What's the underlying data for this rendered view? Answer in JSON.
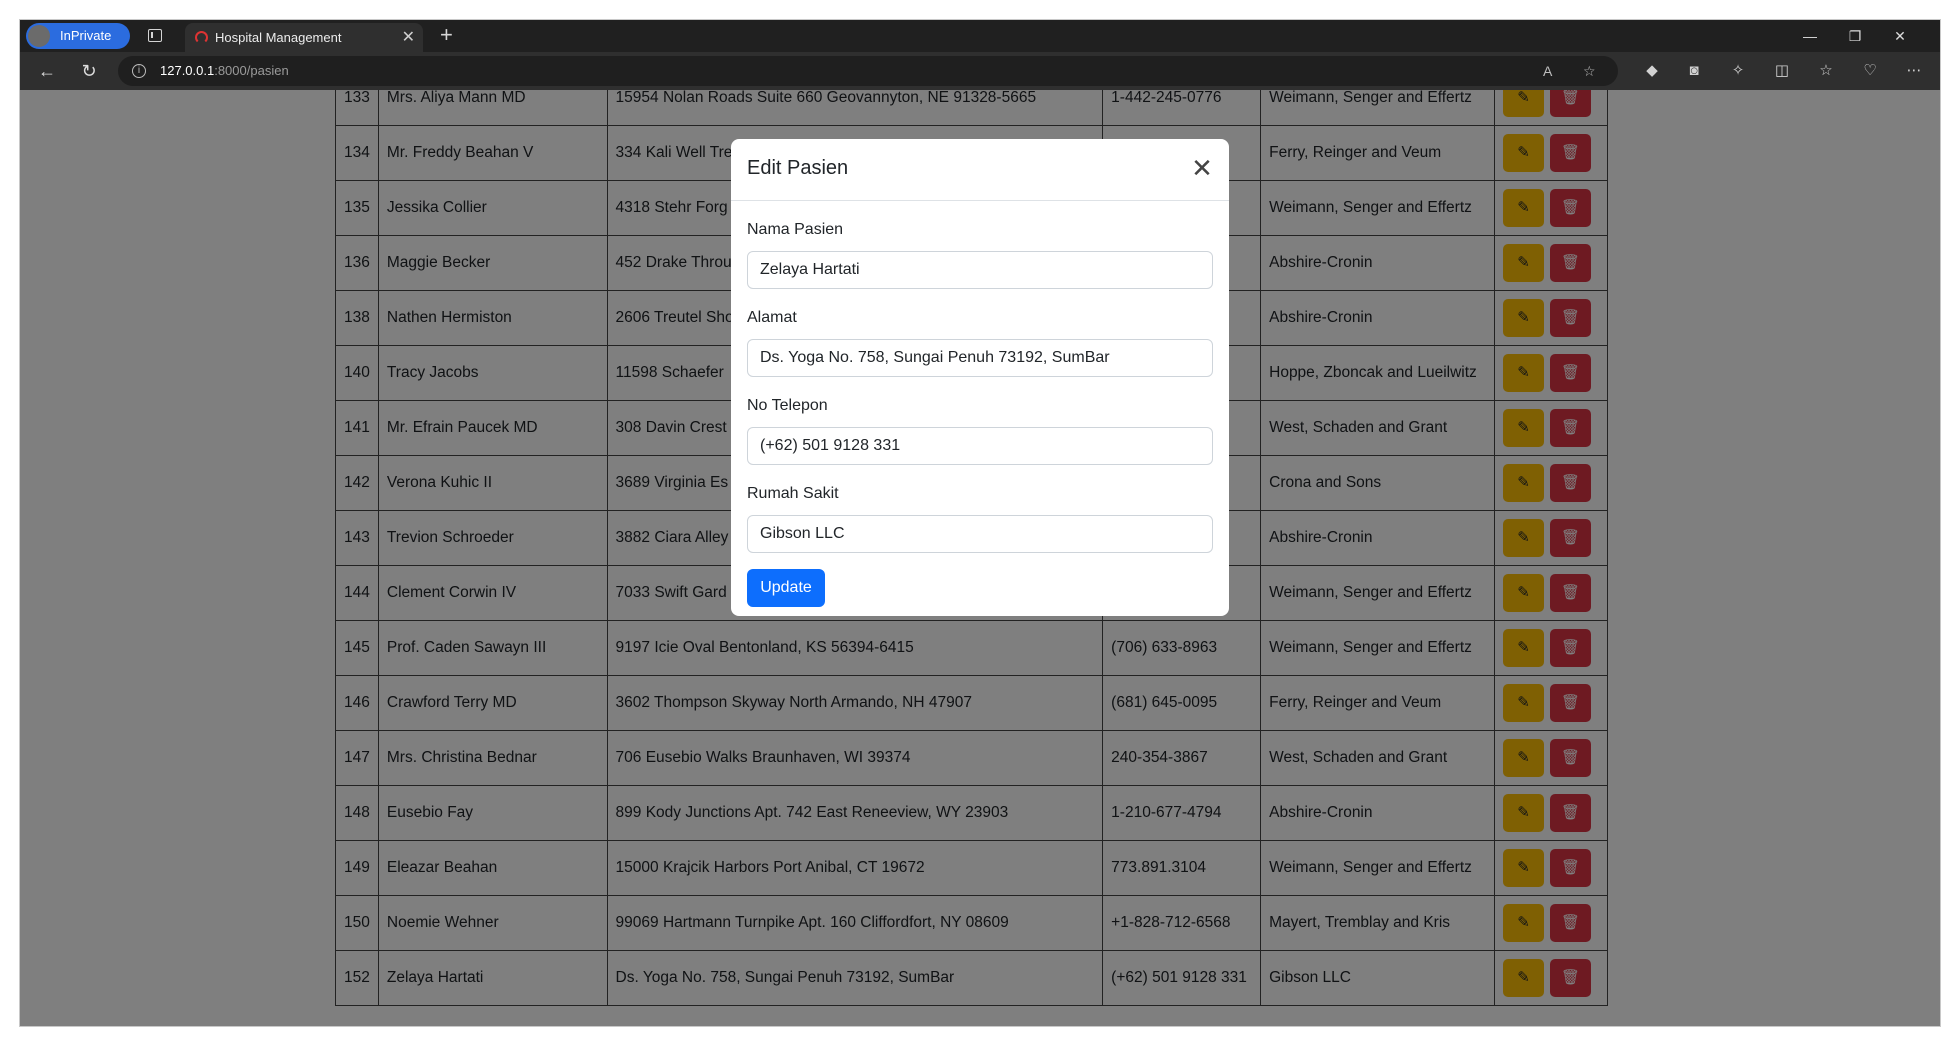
{
  "browser": {
    "profile_label": "InPrivate (2)",
    "tab_title": "Hospital Management",
    "url_host": "127.0.0.1",
    "url_rest": ":8000/pasien"
  },
  "patients": [
    {
      "id": "133",
      "name": "Mrs. Aliya Mann MD",
      "address": "15954 Nolan Roads Suite 660 Geovannyton, NE 91328-5665",
      "phone": "1-442-245-0776",
      "hospital": "Weimann, Senger and Effertz"
    },
    {
      "id": "134",
      "name": "Mr. Freddy Beahan V",
      "address": "334 Kali Well Tre",
      "phone": "4",
      "hospital": "Ferry, Reinger and Veum"
    },
    {
      "id": "135",
      "name": "Jessika Collier",
      "address": "4318 Stehr Forg",
      "phone": "",
      "hospital": "Weimann, Senger and Effertz"
    },
    {
      "id": "136",
      "name": "Maggie Becker",
      "address": "452 Drake Throu",
      "phone": "",
      "hospital": "Abshire-Cronin"
    },
    {
      "id": "138",
      "name": "Nathen Hermiston",
      "address": "2606 Treutel Sho",
      "phone": "",
      "hospital": "Abshire-Cronin"
    },
    {
      "id": "140",
      "name": "Tracy Jacobs",
      "address": "11598 Schaefer",
      "phone": "",
      "hospital": "Hoppe, Zboncak and Lueilwitz"
    },
    {
      "id": "141",
      "name": "Mr. Efrain Paucek MD",
      "address": "308 Davin Crest",
      "phone": "",
      "hospital": "West, Schaden and Grant"
    },
    {
      "id": "142",
      "name": "Verona Kuhic II",
      "address": "3689 Virginia Es",
      "phone": "",
      "hospital": "Crona and Sons"
    },
    {
      "id": "143",
      "name": "Trevion Schroeder",
      "address": "3882 Ciara Alley",
      "phone": "",
      "hospital": "Abshire-Cronin"
    },
    {
      "id": "144",
      "name": "Clement Corwin IV",
      "address": "7033 Swift Gard",
      "phone": "9",
      "hospital": "Weimann, Senger and Effertz"
    },
    {
      "id": "145",
      "name": "Prof. Caden Sawayn III",
      "address": "9197 Icie Oval Bentonland, KS 56394-6415",
      "phone": "(706) 633-8963",
      "hospital": "Weimann, Senger and Effertz"
    },
    {
      "id": "146",
      "name": "Crawford Terry MD",
      "address": "3602 Thompson Skyway North Armando, NH 47907",
      "phone": "(681) 645-0095",
      "hospital": "Ferry, Reinger and Veum"
    },
    {
      "id": "147",
      "name": "Mrs. Christina Bednar",
      "address": "706 Eusebio Walks Braunhaven, WI 39374",
      "phone": "240-354-3867",
      "hospital": "West, Schaden and Grant"
    },
    {
      "id": "148",
      "name": "Eusebio Fay",
      "address": "899 Kody Junctions Apt. 742 East Reneeview, WY 23903",
      "phone": "1-210-677-4794",
      "hospital": "Abshire-Cronin"
    },
    {
      "id": "149",
      "name": "Eleazar Beahan",
      "address": "15000 Krajcik Harbors Port Anibal, CT 19672",
      "phone": "773.891.3104",
      "hospital": "Weimann, Senger and Effertz"
    },
    {
      "id": "150",
      "name": "Noemie Wehner",
      "address": "99069 Hartmann Turnpike Apt. 160 Cliffordfort, NY 08609",
      "phone": "+1-828-712-6568",
      "hospital": "Mayert, Tremblay and Kris"
    },
    {
      "id": "152",
      "name": "Zelaya Hartati",
      "address": "Ds. Yoga No. 758, Sungai Penuh 73192, SumBar",
      "phone": "(+62) 501 9128 331",
      "hospital": "Gibson LLC"
    }
  ],
  "modal": {
    "title": "Edit Pasien",
    "name_label": "Nama Pasien",
    "name_value": "Zelaya Hartati",
    "address_label": "Alamat",
    "address_value": "Ds. Yoga No. 758, Sungai Penuh 73192, SumBar",
    "phone_label": "No Telepon",
    "phone_value": "(+62) 501 9128 331",
    "hospital_label": "Rumah Sakit",
    "hospital_value": "Gibson LLC",
    "update_label": "Update"
  },
  "colors": {
    "edit_button": "#ffc107",
    "delete_button": "#dc3545",
    "primary": "#0d6efd"
  },
  "icons": {
    "edit": "pencil-square-icon",
    "delete": "trash-icon",
    "close": "close-icon"
  }
}
